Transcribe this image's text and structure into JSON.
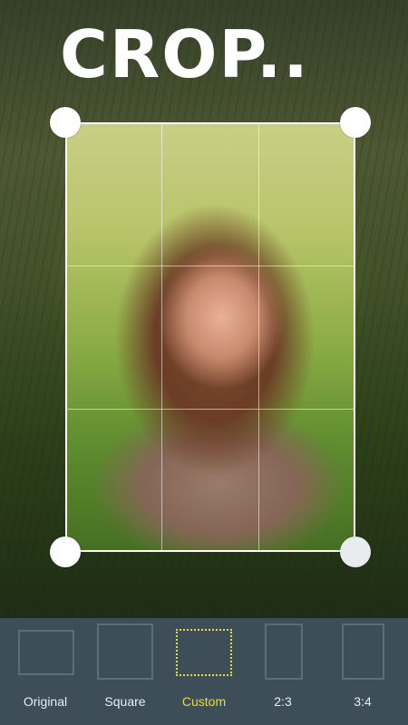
{
  "header": {
    "title": "CROP.."
  },
  "crop_options": [
    {
      "label": "Original",
      "selected": false
    },
    {
      "label": "Square",
      "selected": false
    },
    {
      "label": "Custom",
      "selected": true
    },
    {
      "label": "2:3",
      "selected": false
    },
    {
      "label": "3:4",
      "selected": false
    }
  ],
  "colors": {
    "accent": "#e5dc45",
    "bottom_bar": "#3e4e58",
    "frame_outline": "#5e6e78",
    "label_text": "#e8eef2",
    "handle": "#ffffff"
  }
}
